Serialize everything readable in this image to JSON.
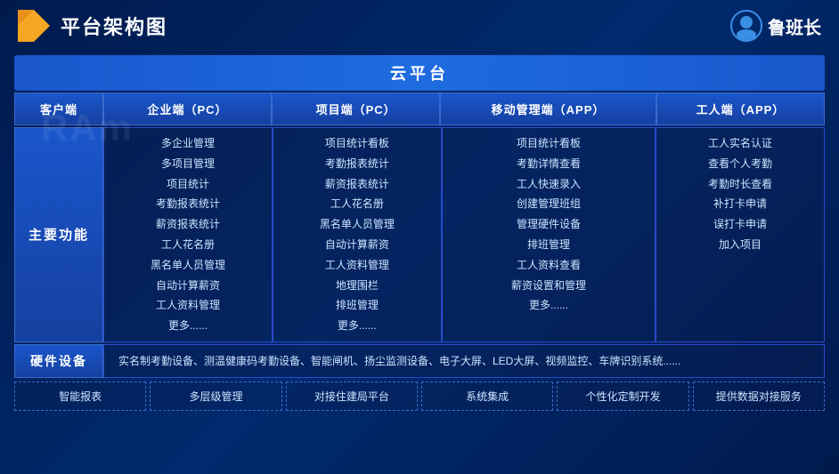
{
  "header": {
    "title": "平台架构图",
    "brand_name": "鲁班长"
  },
  "cloud": {
    "banner_label": "云平台"
  },
  "columns": {
    "client": "客户端",
    "enterprise": "企业端（PC）",
    "project": "项目端（PC）",
    "mobile": "移动管理端（APP）",
    "worker": "工人端（APP）"
  },
  "rows": {
    "main_func_label": "主要功能",
    "enterprise_items": "多企业管理\n多项目管理\n项目统计\n考勤报表统计\n薪资报表统计\n工人花名册\n黑名单人员管理\n自动计算薪资\n工人资料管理\n更多......",
    "project_items": "项目统计看板\n考勤报表统计\n薪资报表统计\n工人花名册\n黑名单人员管理\n自动计算薪资\n工人资料管理\n地理围栏\n排班管理\n更多......",
    "mobile_items": "项目统计看板\n考勤详情查看\n工人快速录入\n创建管理班组\n管理硬件设备\n排班管理\n工人资料查看\n薪资设置和管理\n更多......",
    "worker_items": "工人实名认证\n查看个人考勤\n考勤时长查看\n补打卡申请\n误打卡申请\n加入项目"
  },
  "hardware": {
    "label": "硬件设备",
    "content": "实名制考勤设备、测温健康码考勤设备、智能闸机、扬尘监测设备、电子大屏、LED大屏、视频监控、车牌识别系统......"
  },
  "features": [
    "智能报表",
    "多层级管理",
    "对接住建局平台",
    "系统集成",
    "个性化定制开发",
    "提供数据对接服务"
  ],
  "ram_text": "RAm"
}
